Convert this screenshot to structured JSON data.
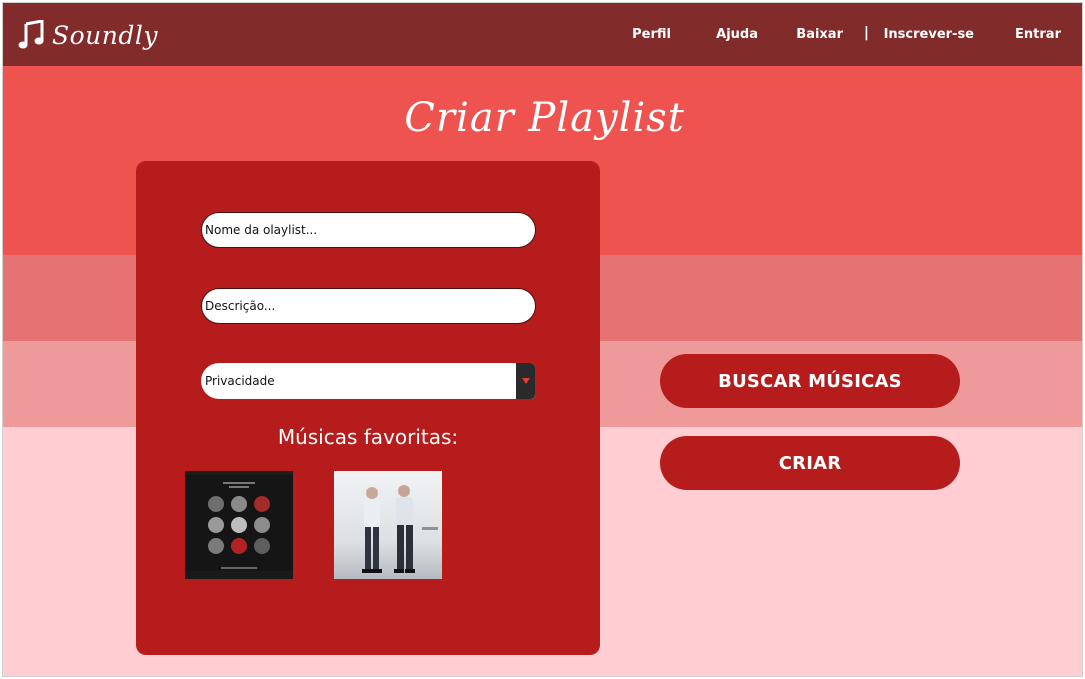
{
  "brand": {
    "name": "Soundly",
    "icon": "music-note-icon"
  },
  "nav": {
    "items": [
      "Perfil",
      "Ajuda",
      "Baixar",
      "Inscrever-se",
      "Entrar"
    ],
    "separator": "|"
  },
  "page": {
    "title": "Criar Playlist"
  },
  "form": {
    "name_placeholder": "Nome da olaylist...",
    "description_placeholder": "Descrição...",
    "privacy_value": "Privacidade",
    "favorites_title": "Músicas favoritas:",
    "albums": [
      "album-cover-1",
      "album-cover-2"
    ]
  },
  "actions": {
    "search_label": "BUSCAR MÚSICAS",
    "create_label": "CRIAR"
  },
  "colors": {
    "header": "#822b2b",
    "band_1": "#ef5350",
    "band_2": "#e57373",
    "band_3": "#ef9a9a",
    "band_4": "#ffcdd2",
    "card": "#b71c1c",
    "button": "#b71c1c"
  }
}
